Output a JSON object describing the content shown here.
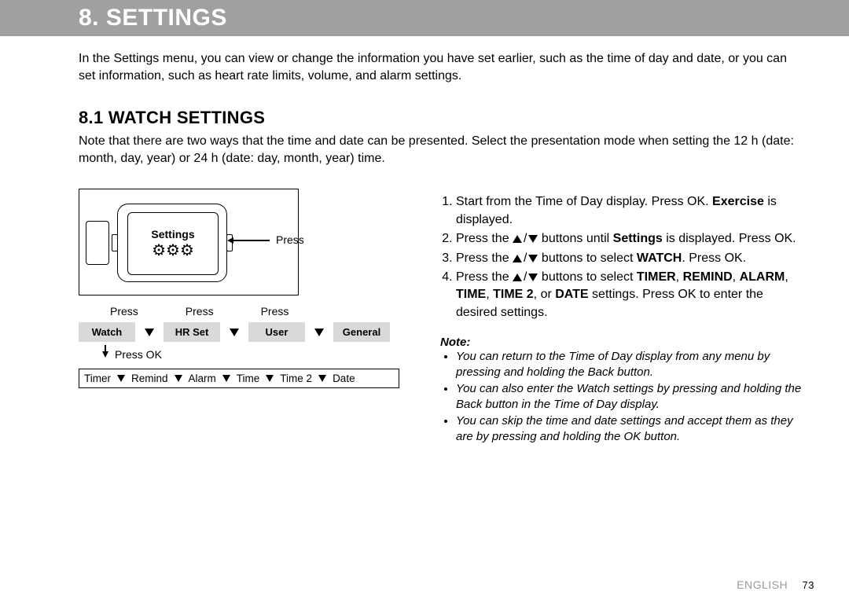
{
  "header": {
    "title": "8. SETTINGS"
  },
  "intro": "In the Settings menu, you can view or change the information you have set earlier, such as the time of day and date, or you can set information, such as heart rate limits, volume, and alarm settings.",
  "sub": {
    "heading": "8.1 WATCH SETTINGS",
    "text": "Note that there are two ways that the time and date can be presented. Select the presentation mode when setting the 12 h (date: month, day, year) or 24 h (date: day, month, year) time."
  },
  "figure": {
    "watch_label": "Settings",
    "press": "Press",
    "press_ok": "Press OK",
    "top_menu": [
      "Watch",
      "HR Set",
      "User",
      "General"
    ],
    "sub_menu": [
      "Timer",
      "Remind",
      "Alarm",
      "Time",
      "Time 2",
      "Date"
    ]
  },
  "steps": {
    "s1a": "Start from the Time of Day display. Press OK. ",
    "s1b": "Exercise",
    "s1c": " is displayed.",
    "s2a": "Press the ",
    "s2b": " buttons until ",
    "s2c": "Settings",
    "s2d": " is displayed. Press OK.",
    "s3a": "Press the ",
    "s3b": " buttons to select ",
    "s3c": "WATCH",
    "s3d": ". Press OK.",
    "s4a": "Press the ",
    "s4b": " buttons to select ",
    "s4c": "TIMER",
    "s4d": "REMIND",
    "s4e": "ALARM",
    "s4f": "TIME",
    "s4g": "TIME 2",
    "s4h": "DATE",
    "s4i": " settings. Press OK to enter the desired settings."
  },
  "note": {
    "heading": "Note:",
    "n1": "You can return to the Time of Day display from any menu by pressing and holding the Back button.",
    "n2": "You can also enter the Watch settings by pressing and holding the Back button in the Time of Day display.",
    "n3": "You can skip the time and date settings and accept them as they are by pressing and holding the OK button."
  },
  "footer": {
    "lang": "ENGLISH",
    "page": "73"
  }
}
